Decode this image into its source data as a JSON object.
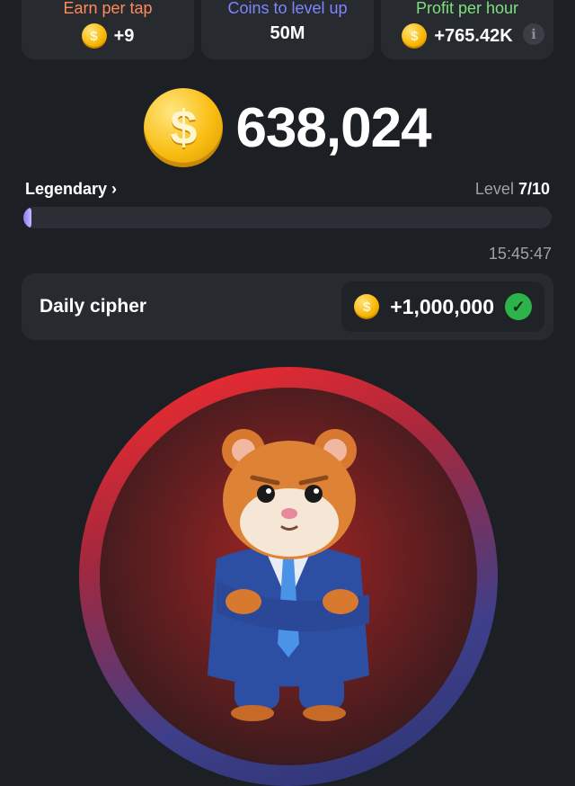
{
  "stats": [
    {
      "label": "Earn per tap",
      "value": "+9",
      "color": "#ff8a5c"
    },
    {
      "label": "Coins to level up",
      "value": "50M",
      "color": "#7d86ff"
    },
    {
      "label": "Profit per hour",
      "value": "+765.42K",
      "color": "#7ee07c"
    }
  ],
  "coin_symbol": "$",
  "info_icon": "i",
  "balance": "638,024",
  "rank": {
    "label": "Legendary",
    "chevron": "›"
  },
  "level": {
    "prefix": "Level",
    "value": "7/10"
  },
  "progress": 0.01,
  "timer": "15:45:47",
  "daily_cipher": {
    "title": "Daily cipher",
    "reward": "+1,000,000",
    "check": "✓",
    "completed": true
  }
}
